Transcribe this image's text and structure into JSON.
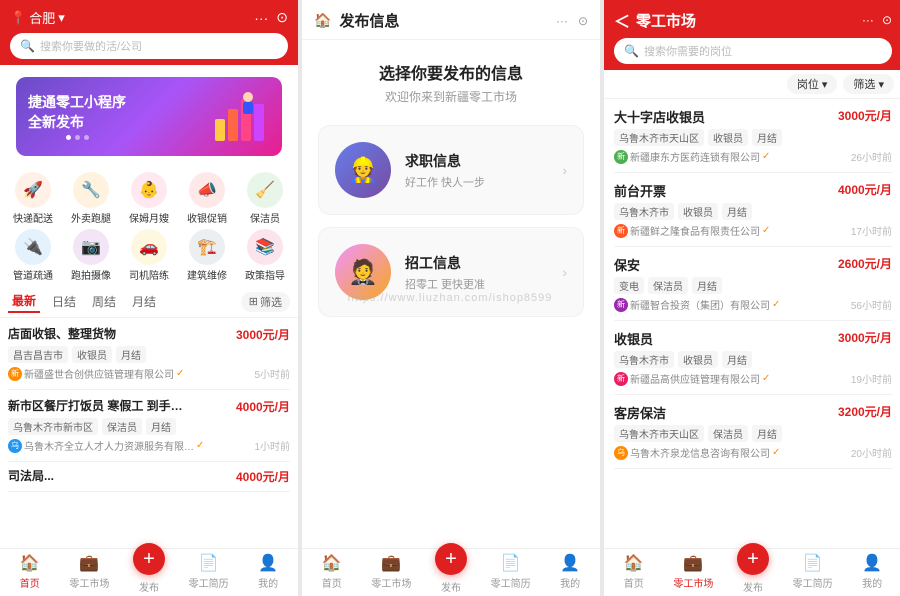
{
  "colors": {
    "primary": "#e02020",
    "accent_orange": "#ff8c00",
    "bg": "#e8e8e8"
  },
  "phone1": {
    "header": {
      "location": "合肥",
      "search_placeholder": "搜索你要做的活/公司",
      "icons": [
        "···",
        "⊙"
      ]
    },
    "banner": {
      "line1": "捷通零工小程序",
      "line2": "全新发布"
    },
    "icon_grid": [
      {
        "icon": "🚀",
        "label": "快递配送",
        "color": "#ff6b35"
      },
      {
        "icon": "🔧",
        "label": "外卖跑腿",
        "color": "#ff8c42"
      },
      {
        "icon": "👶",
        "label": "保姆月嫂",
        "color": "#ff5e78"
      },
      {
        "icon": "📣",
        "label": "收银促销",
        "color": "#ff4d4d"
      },
      {
        "icon": "🧹",
        "label": "保洁员",
        "color": "#4caf50"
      },
      {
        "icon": "🔌",
        "label": "管道疏通",
        "color": "#2196f3"
      },
      {
        "icon": "📷",
        "label": "跑拍摄像",
        "color": "#9c27b0"
      },
      {
        "icon": "🚗",
        "label": "司机陪练",
        "color": "#ff9800"
      },
      {
        "icon": "🏗️",
        "label": "建筑维修",
        "color": "#607d8b"
      },
      {
        "icon": "📚",
        "label": "政策指导",
        "color": "#e91e63"
      }
    ],
    "tabs": [
      {
        "label": "最新",
        "active": true
      },
      {
        "label": "日结",
        "active": false
      },
      {
        "label": "周结",
        "active": false
      },
      {
        "label": "月结",
        "active": false
      },
      {
        "label": "筛选",
        "active": false
      }
    ],
    "jobs": [
      {
        "title": "店面收银、整理货物",
        "salary": "3000元/月",
        "tags": [
          "昌吉昌吉市",
          "收银员",
          "月结"
        ],
        "company": "新疆盛世合创供应链管理有限公司",
        "time": "5小时前",
        "verified": true
      },
      {
        "title": "新市区餐厅打饭员 寒假工 到手…",
        "salary": "4000元/月",
        "tags": [
          "乌鲁木齐市新市区",
          "保洁员",
          "月结"
        ],
        "company": "乌鲁木齐全立人才人力资源服务有限…",
        "time": "1小时前",
        "verified": true
      }
    ],
    "nav": [
      {
        "label": "首页",
        "icon": "🏠",
        "active": true
      },
      {
        "label": "零工市场",
        "icon": "💼",
        "active": false
      },
      {
        "label": "发布",
        "icon": "+",
        "active": false,
        "isPlus": true
      },
      {
        "label": "零工简历",
        "icon": "📄",
        "active": false
      },
      {
        "label": "我的",
        "icon": "👤",
        "active": false
      }
    ]
  },
  "phone2": {
    "header": {
      "icon": "🏠",
      "title": "发布信息",
      "dots": "···",
      "target": "⊙"
    },
    "welcome": "欢迎你来到新疆零工市场",
    "prompt": "选择你要发布的信息",
    "cards": [
      {
        "icon": "👷",
        "title": "求职信息",
        "subtitle": "好工作 快人一步",
        "color": "blue"
      },
      {
        "icon": "🤵",
        "title": "招工信息",
        "subtitle": "招零工 更快更准",
        "color": "orange"
      }
    ],
    "nav": [
      {
        "label": "首页",
        "icon": "🏠",
        "active": false
      },
      {
        "label": "零工市场",
        "icon": "💼",
        "active": false
      },
      {
        "label": "发布",
        "icon": "+",
        "active": false,
        "isPlus": true
      },
      {
        "label": "零工简历",
        "icon": "📄",
        "active": false
      },
      {
        "label": "我的",
        "icon": "👤",
        "active": false
      }
    ]
  },
  "phone3": {
    "header": {
      "back": "＜",
      "title": "零工市场",
      "dots": "···",
      "target": "⊙",
      "search_placeholder": "搜索你需要的岗位"
    },
    "filters": [
      {
        "label": "岗位 ▾"
      },
      {
        "label": "筛选 ▾"
      }
    ],
    "jobs": [
      {
        "title": "大十字店收银员",
        "salary": "3000元/月",
        "tags": [
          "乌鲁木齐市天山区",
          "收银员",
          "月结"
        ],
        "company": "新疆康东方医药连锁有限公司",
        "time": "26小时前",
        "verified": true
      },
      {
        "title": "前台开票",
        "salary": "4000元/月",
        "tags": [
          "乌鲁木齐市",
          "收银员",
          "月结"
        ],
        "company": "新疆鲜之隆食品有限责任公司",
        "time": "17小时前",
        "verified": true
      },
      {
        "title": "保安",
        "salary": "2600元/月",
        "tags": [
          "变电",
          "保洁员",
          "月结"
        ],
        "company": "新疆智合投资（集团）有限公司",
        "time": "56小时前",
        "verified": true
      },
      {
        "title": "收银员",
        "salary": "3000元/月",
        "tags": [
          "乌鲁木齐市",
          "收银员",
          "月结"
        ],
        "company": "新疆品高供应链管理有限公司",
        "time": "19小时前",
        "verified": true
      },
      {
        "title": "客房保洁",
        "salary": "3200元/月",
        "tags": [
          "乌鲁木齐市天山区",
          "保洁员",
          "月结"
        ],
        "company": "乌鲁木齐泉龙信息咨询有限公司",
        "time": "20小时前",
        "verified": true
      }
    ],
    "nav": [
      {
        "label": "首页",
        "icon": "🏠",
        "active": false
      },
      {
        "label": "零工市场",
        "icon": "💼",
        "active": true
      },
      {
        "label": "发布",
        "icon": "+",
        "active": false,
        "isPlus": true
      },
      {
        "label": "零工简历",
        "icon": "📄",
        "active": false
      },
      {
        "label": "我的",
        "icon": "👤",
        "active": false
      }
    ]
  },
  "watermark": "https://www.liuzhan.com/ishop8599"
}
